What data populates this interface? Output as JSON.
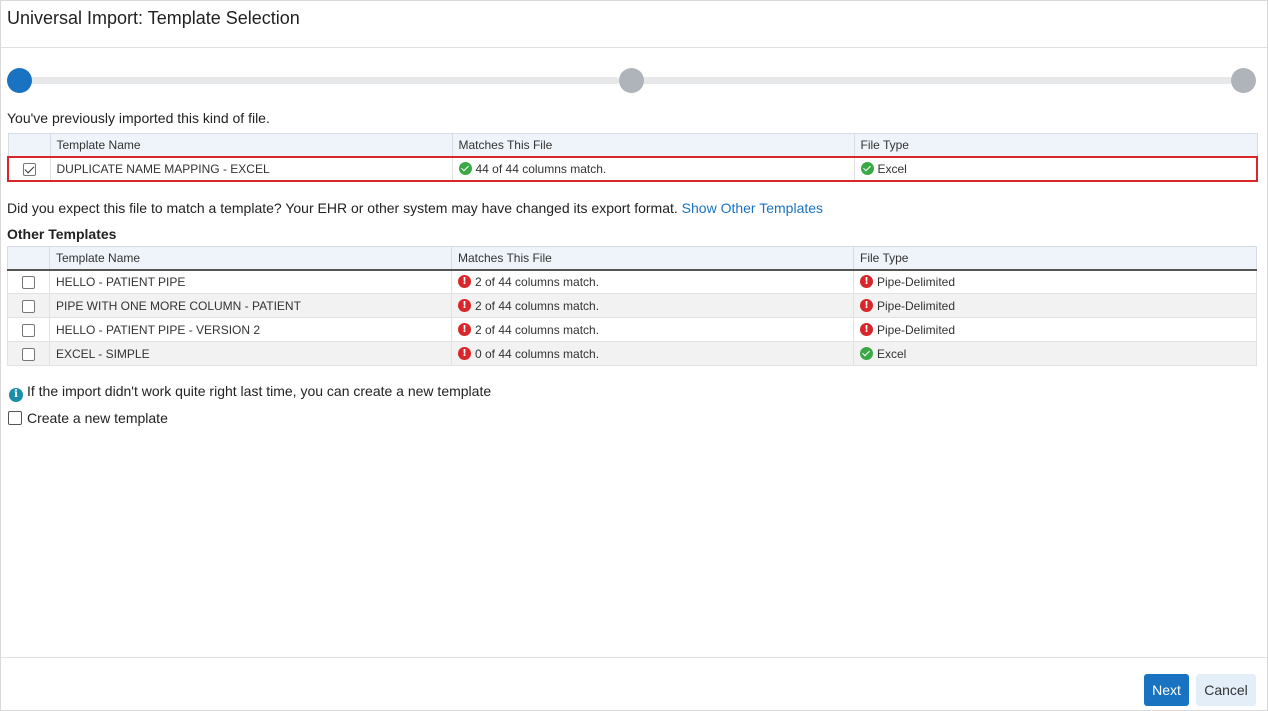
{
  "window": {
    "title": "Universal Import: Template Selection"
  },
  "stepper": {
    "steps": 3,
    "active_step": 1
  },
  "previous": {
    "intro": "You've previously imported this kind of file.",
    "columns": [
      "Template Name",
      "Matches This File",
      "File Type"
    ],
    "rows": [
      {
        "checked": true,
        "name": "DUPLICATE NAME MAPPING - EXCEL",
        "match_status": "ok",
        "match": "44 of 44 columns match.",
        "type_status": "ok",
        "type": "Excel"
      }
    ]
  },
  "expect": {
    "text": "Did you expect this file to match a template? Your EHR or other system may have changed its export format.",
    "link": "Show Other Templates"
  },
  "other": {
    "title": "Other Templates",
    "columns": [
      "Template Name",
      "Matches This File",
      "File Type"
    ],
    "rows": [
      {
        "checked": false,
        "name": "HELLO - PATIENT PIPE",
        "match_status": "err",
        "match": "2 of 44 columns match.",
        "type_status": "err",
        "type": "Pipe-Delimited"
      },
      {
        "checked": false,
        "name": "PIPE WITH ONE MORE COLUMN - PATIENT",
        "match_status": "err",
        "match": "2 of 44 columns match.",
        "type_status": "err",
        "type": "Pipe-Delimited"
      },
      {
        "checked": false,
        "name": "HELLO - PATIENT PIPE - VERSION 2",
        "match_status": "err",
        "match": "2 of 44 columns match.",
        "type_status": "err",
        "type": "Pipe-Delimited"
      },
      {
        "checked": false,
        "name": "EXCEL - SIMPLE",
        "match_status": "err",
        "match": "0 of 44 columns match.",
        "type_status": "ok",
        "type": "Excel"
      }
    ]
  },
  "info": {
    "icon": "info-icon",
    "text": "If the import didn't work quite right last time, you can create a new template"
  },
  "create": {
    "label": "Create a new template",
    "checked": false
  },
  "buttons": {
    "next": "Next",
    "cancel": "Cancel"
  },
  "colors": {
    "accent": "#1a73c0",
    "success": "#3aa845",
    "error": "#d9262a",
    "highlight_border": "#d9262a",
    "info": "#1b8fa8"
  }
}
